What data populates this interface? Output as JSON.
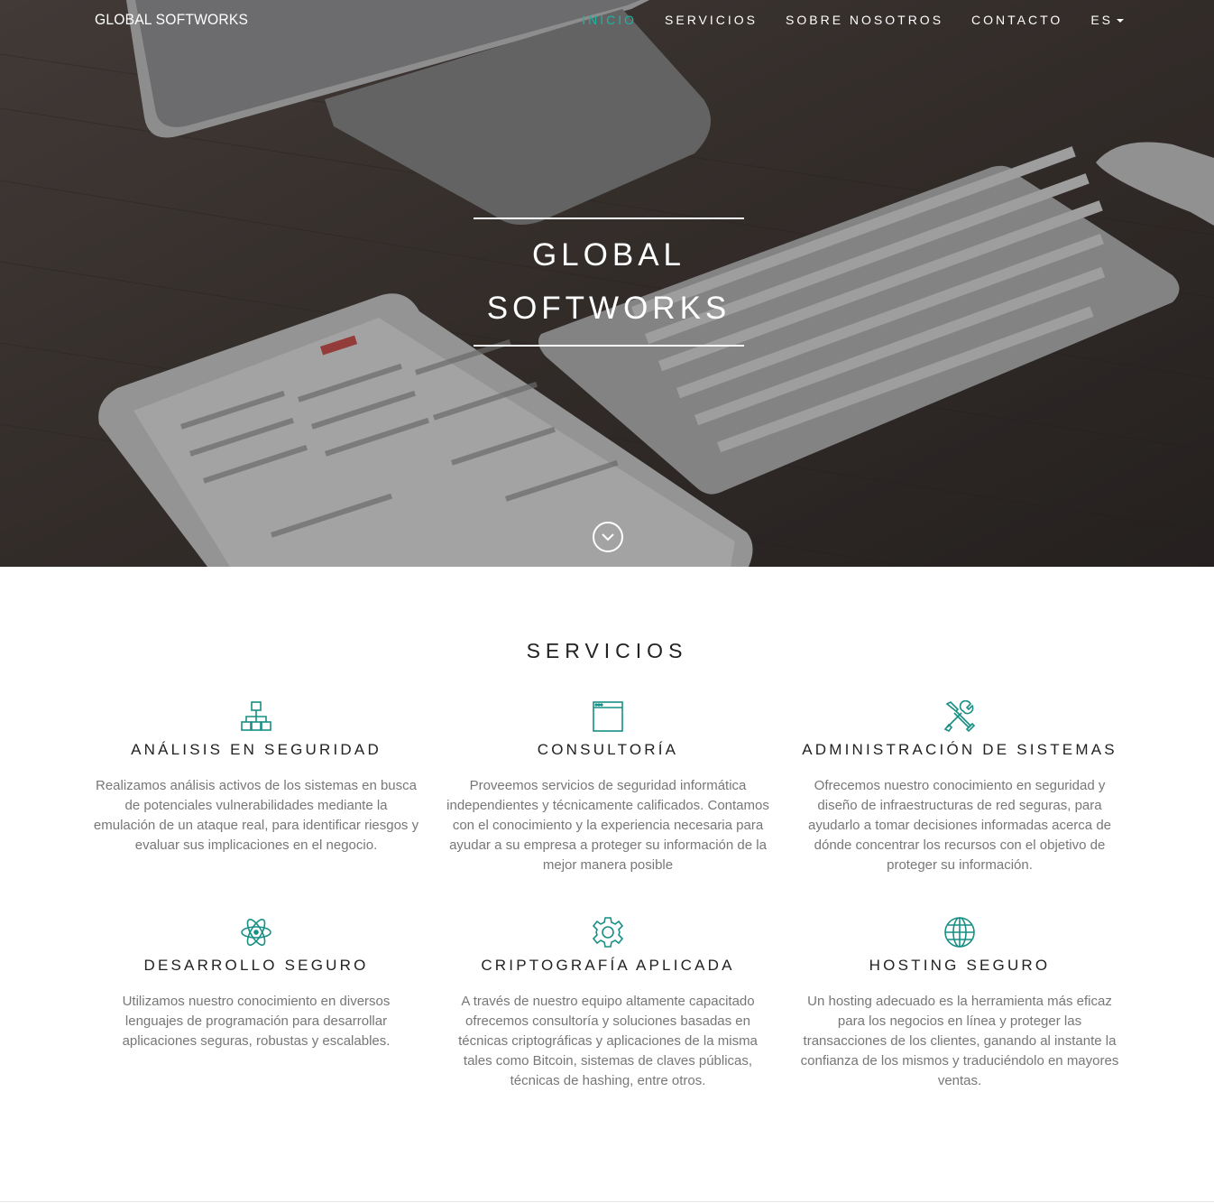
{
  "nav": {
    "brand": "GLOBAL SOFTWORKS",
    "items": [
      {
        "label": "INICIO",
        "active": true
      },
      {
        "label": "SERVICIOS",
        "active": false
      },
      {
        "label": "SOBRE NOSOTROS",
        "active": false
      },
      {
        "label": "CONTACTO",
        "active": false
      }
    ],
    "language": "ES"
  },
  "hero": {
    "title_line1": "GLOBAL",
    "title_line2": "SOFTWORKS",
    "scroll_icon": "chevron-down-circle-icon"
  },
  "services": {
    "title": "SERVICIOS",
    "items": [
      {
        "icon": "network-hierarchy-icon",
        "title": "ANÁLISIS EN SEGURIDAD",
        "text": "Realizamos análisis activos de los sistemas en busca de potenciales vulnerabilidades mediante la emulación de un ataque real, para identificar riesgos y evaluar sus implicaciones en el negocio."
      },
      {
        "icon": "browser-window-icon",
        "title": "CONSULTORÍA",
        "text": "Proveemos servicios de seguridad informática independientes y técnicamente calificados. Contamos con el conocimiento y la experiencia necesaria para ayudar a su empresa a proteger su información de la mejor manera posible"
      },
      {
        "icon": "tools-icon",
        "title": "ADMINISTRACIÓN DE SISTEMAS",
        "text": "Ofrecemos nuestro conocimiento en seguridad y diseño de infraestructuras de red seguras, para ayudarlo a tomar decisiones informadas acerca de dónde concentrar los recursos con el objetivo de proteger su información."
      },
      {
        "icon": "atom-icon",
        "title": "DESARROLLO SEGURO",
        "text": "Utilizamos nuestro conocimiento en diversos lenguajes de programación para desarrollar aplicaciones seguras, robustas y escalables."
      },
      {
        "icon": "gear-icon",
        "title": "CRIPTOGRAFÍA APLICADA",
        "text": "A través de nuestro equipo altamente capacitado ofrecemos consultoría y soluciones basadas en técnicas criptográficas y aplicaciones de la misma tales como Bitcoin, sistemas de claves públicas, técnicas de hashing, entre otros."
      },
      {
        "icon": "globe-icon",
        "title": "HOSTING SEGURO",
        "text": "Un hosting adecuado es la herramienta más eficaz para los negocios en línea y proteger las transacciones de los clientes, ganando al instante la confianza de los mismos y traduciéndolo en mayores ventas."
      }
    ]
  },
  "colors": {
    "accent": "#1ab5a2",
    "icon": "#178f84",
    "heading": "#222222",
    "body_text": "#777777"
  }
}
